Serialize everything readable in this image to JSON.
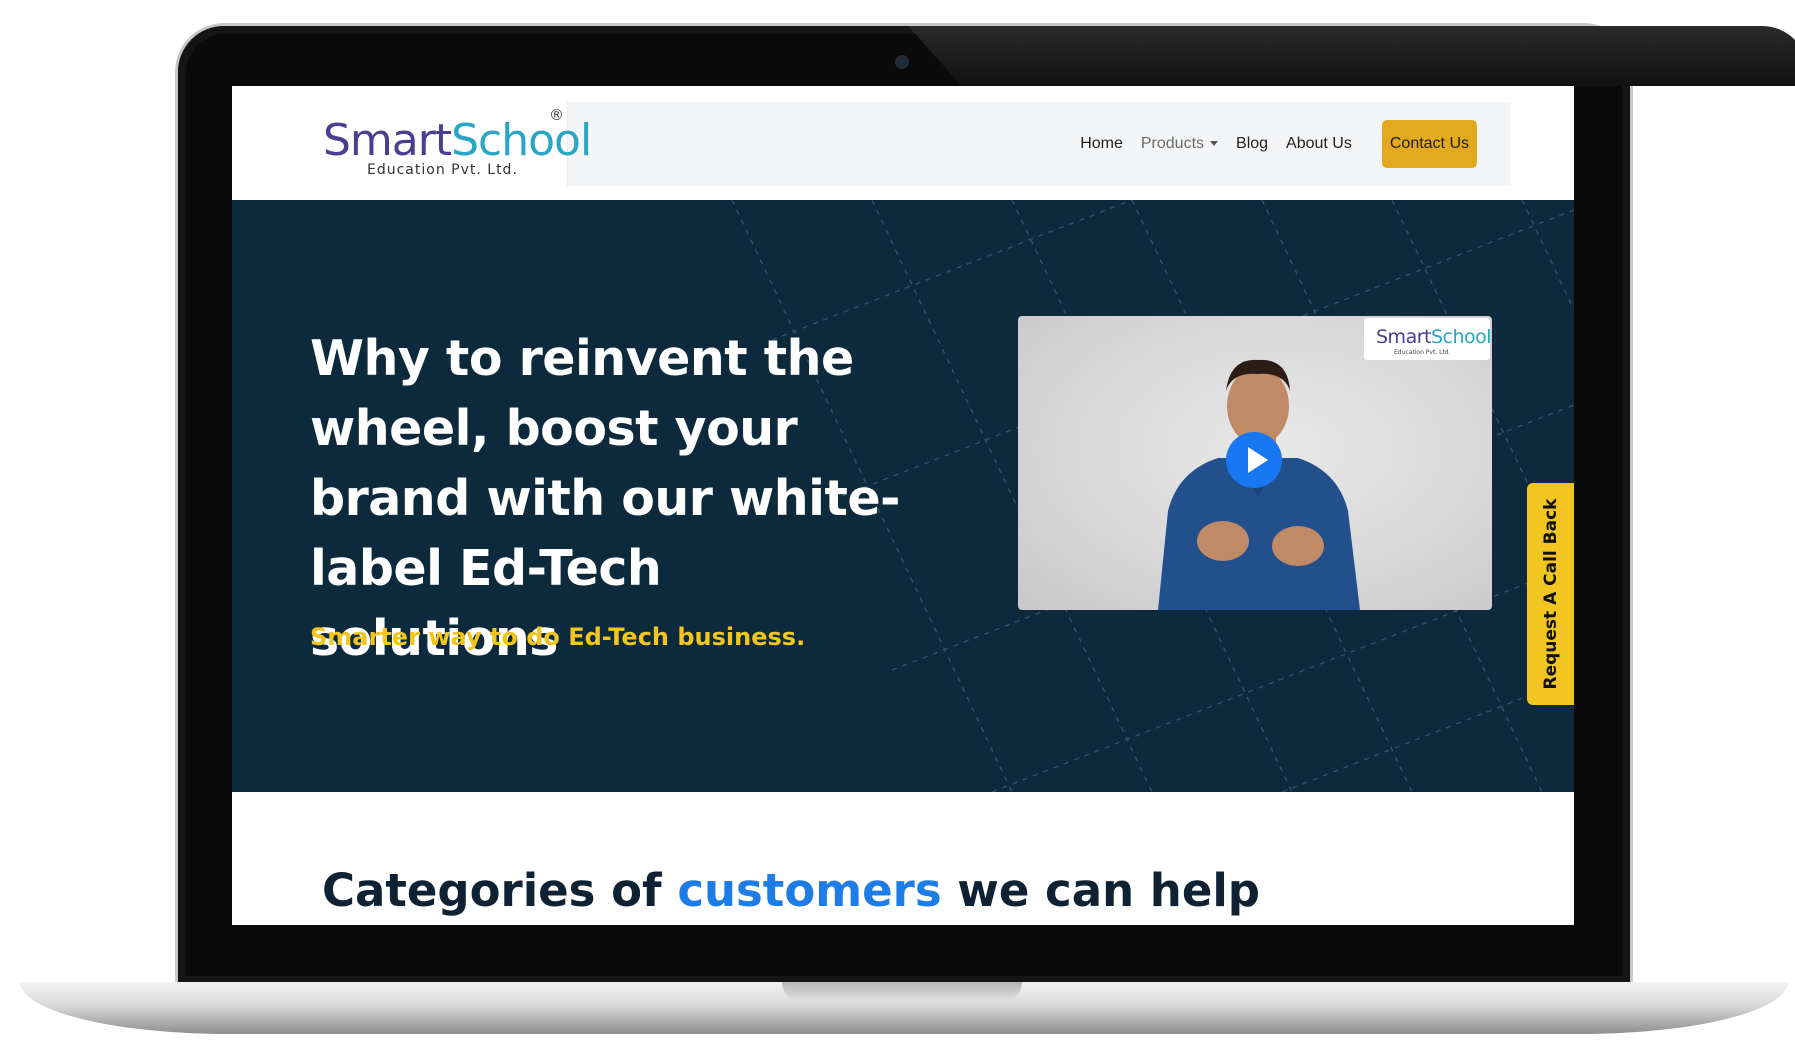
{
  "logo": {
    "brand_a": "Smart",
    "brand_b": "School",
    "registered": "®",
    "subtitle": "Education Pvt. Ltd."
  },
  "nav": {
    "items": [
      "Home",
      "Products",
      "Blog",
      "About Us"
    ],
    "contact_label": "Contact Us"
  },
  "hero": {
    "title": "Why to reinvent the wheel, boost your brand with our white-label Ed-Tech solutions",
    "subtitle": "Smarter way to do Ed-Tech business.",
    "video_logo_a": "Smart",
    "video_logo_b": "School",
    "video_logo_sub": "Education Pvt. Ltd."
  },
  "callback": {
    "label": "Request A Call Back"
  },
  "categories": {
    "part1": "Categories of ",
    "highlight": "customers",
    "part2": " we can help"
  },
  "colors": {
    "hero_bg": "#0d2a3d",
    "accent_yellow": "#f2c521",
    "contact_button": "#e3a91f",
    "highlight_blue": "#1e7ce6",
    "play_button": "#1877f2"
  }
}
